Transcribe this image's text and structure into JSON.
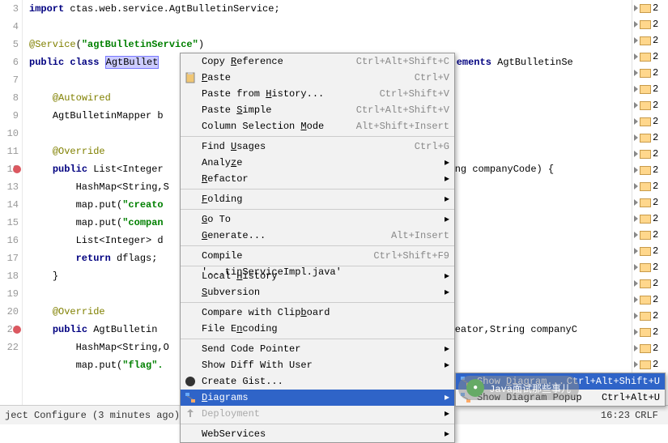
{
  "gutter_lines": [
    "3",
    "4",
    "5",
    "6",
    "7",
    "8",
    "9",
    "10",
    "11",
    "12",
    "13",
    "14",
    "15",
    "16",
    "17",
    "18",
    "19",
    "20",
    "21",
    "22"
  ],
  "code": {
    "r3": {
      "kw": "import",
      "pkg": " ctas.web.service.AgtBulletinService;"
    },
    "r5": {
      "ann": "@Service",
      "str": "\"agtBulletinService\""
    },
    "r6": {
      "kw1": "public class ",
      "sel": "AgtBullet",
      "rest": " ",
      "kw2": "ements",
      "tail": " AgtBulletinSe"
    },
    "r8": {
      "ann": "@Autowired"
    },
    "r9": {
      "txt": "AgtBulletinMapper b"
    },
    "r11": {
      "ann": "@Override"
    },
    "r12": {
      "kw": "public ",
      "typ": "List<Integer",
      "txt": "",
      "tail": "ring companyCode) {"
    },
    "r13": {
      "txt": "HashMap<String,S"
    },
    "r14": {
      "txt": "map.put(",
      "str": "\"creato"
    },
    "r15": {
      "txt": "map.put(",
      "str": "\"compan"
    },
    "r16": {
      "txt": "List<Integer> d"
    },
    "r17": {
      "kw": "return ",
      "txt": "dflags;"
    },
    "r18": {
      "txt": "}"
    },
    "r20": {
      "ann": "@Override"
    },
    "r21": {
      "kw": "public ",
      "txt": "AgtBulletin",
      "tail": "reator,String companyC"
    },
    "r22": {
      "txt": "HashMap<String,O"
    },
    "r23": {
      "txt": "map.put(",
      "str": "\"flag\"."
    }
  },
  "context_menu": [
    {
      "label": "Copy Reference",
      "shortcut": "Ctrl+Alt+Shift+C",
      "u": "R"
    },
    {
      "label": "Paste",
      "shortcut": "Ctrl+V",
      "icon": "paste",
      "u": "P"
    },
    {
      "label": "Paste from History...",
      "shortcut": "Ctrl+Shift+V",
      "u": "H"
    },
    {
      "label": "Paste Simple",
      "shortcut": "Ctrl+Alt+Shift+V",
      "u": "S"
    },
    {
      "label": "Column Selection Mode",
      "shortcut": "Alt+Shift+Insert",
      "u": "M"
    },
    {
      "sep": true
    },
    {
      "label": "Find Usages",
      "shortcut": "Ctrl+G",
      "u": "U"
    },
    {
      "label": "Analyze",
      "sub": true,
      "u": "z"
    },
    {
      "label": "Refactor",
      "sub": true,
      "u": "R"
    },
    {
      "sep": true
    },
    {
      "label": "Folding",
      "sub": true,
      "u": "F"
    },
    {
      "sep": true
    },
    {
      "label": "Go To",
      "sub": true,
      "u": "G"
    },
    {
      "label": "Generate...",
      "shortcut": "Alt+Insert",
      "u": "G"
    },
    {
      "sep": true
    },
    {
      "label": "Compile '...tinServiceImpl.java'",
      "shortcut": "Ctrl+Shift+F9"
    },
    {
      "sep": true
    },
    {
      "label": "Local History",
      "sub": true,
      "u": "H"
    },
    {
      "label": "Subversion",
      "sub": true,
      "u": "S"
    },
    {
      "sep": true
    },
    {
      "label": "Compare with Clipboard",
      "u": "b"
    },
    {
      "label": "File Encoding",
      "u": "n"
    },
    {
      "sep": true
    },
    {
      "label": "Send Code Pointer",
      "sub": true
    },
    {
      "label": "Show Diff With User",
      "sub": true
    },
    {
      "label": "Create Gist...",
      "icon": "gist"
    },
    {
      "label": "Diagrams",
      "sub": true,
      "hov": true,
      "icon": "diag",
      "u": "D"
    },
    {
      "label": "Deployment",
      "sub": true,
      "dis": true,
      "icon": "deploy"
    },
    {
      "sep": true
    },
    {
      "label": "WebServices",
      "sub": true
    }
  ],
  "submenu": [
    {
      "label": "Show Diagram...",
      "shortcut": "Ctrl+Alt+Shift+U",
      "hov": true,
      "icon": "diag",
      "u": "D"
    },
    {
      "label": "Show Diagram Popup",
      "shortcut": "Ctrl+Alt+U",
      "icon": "diag"
    }
  ],
  "project_items": [
    "2",
    "2",
    "2",
    "2",
    "2",
    "2",
    "2",
    "2",
    "2",
    "2",
    "2",
    "2",
    "2",
    "2",
    "2",
    "2",
    "2",
    "2",
    "2",
    "2",
    "2",
    "2",
    "2",
    "2"
  ],
  "status": {
    "left": "ject Configure (3 minutes ago)",
    "time": "16:23",
    "crlf": "CRLF",
    "enc": ""
  },
  "watermark": "Java面试那些事儿"
}
